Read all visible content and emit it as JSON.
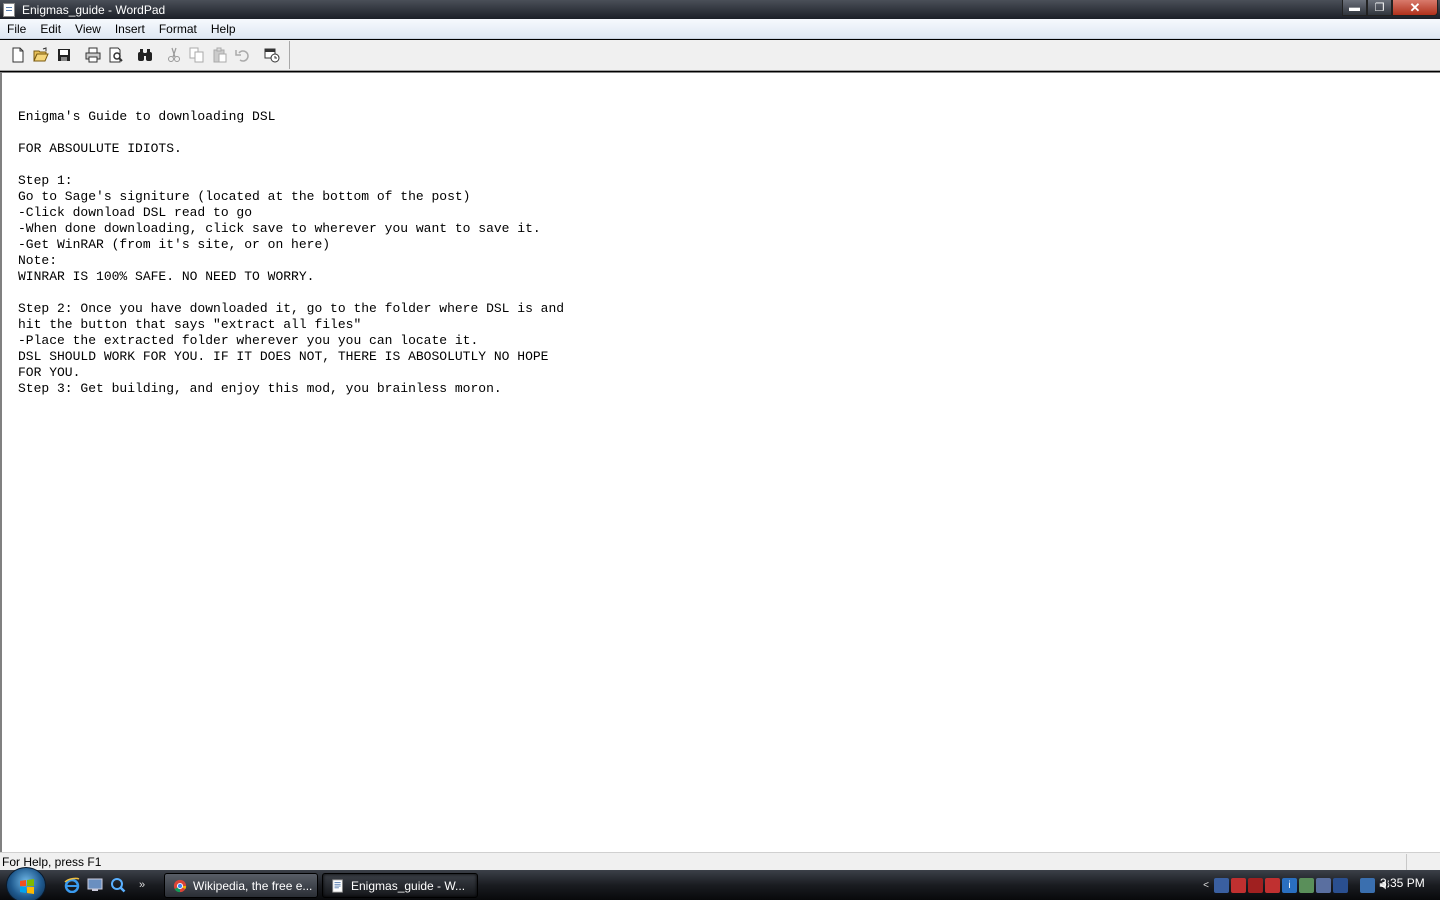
{
  "window": {
    "title": "Enigmas_guide - WordPad",
    "controls": {
      "minimize": "▬",
      "maximize": "❐",
      "close": "✕"
    }
  },
  "menu": [
    "File",
    "Edit",
    "View",
    "Insert",
    "Format",
    "Help"
  ],
  "toolbar": {
    "buttons": [
      "new-icon",
      "open-icon",
      "save-icon",
      "print-icon",
      "print-preview-icon",
      "find-icon",
      "cut-icon",
      "copy-icon",
      "paste-icon",
      "undo-icon",
      "date-time-icon"
    ]
  },
  "document": {
    "lines": [
      "",
      "Enigma's Guide to downloading DSL",
      "",
      "FOR ABSOULUTE IDIOTS.",
      "",
      "Step 1:",
      "Go to Sage's signiture (located at the bottom of the post)",
      "-Click download DSL read to go",
      "-When done downloading, click save to wherever you want to save it.",
      "-Get WinRAR (from it's site, or on here)",
      "Note:",
      "WINRAR IS 100% SAFE. NO NEED TO WORRY.",
      "",
      "Step 2: Once you have downloaded it, go to the folder where DSL is and",
      "hit the button that says \"extract all files\"",
      "-Place the extracted folder wherever you you can locate it.",
      "DSL SHOULD WORK FOR YOU. IF IT DOES NOT, THERE IS ABOSOLUTLY NO HOPE",
      "FOR YOU.",
      "Step 3: Get building, and enjoy this mod, you brainless moron."
    ]
  },
  "status": {
    "text": "For Help, press F1"
  },
  "taskbar": {
    "quick_launch": [
      "internet-explorer-icon",
      "show-desktop-icon",
      "search-icon"
    ],
    "more_label": "»",
    "tasks": [
      {
        "label": "Wikipedia, the free e...",
        "icon": "chrome-icon",
        "active": false
      },
      {
        "label": "Enigmas_guide - W...",
        "icon": "wordpad-icon",
        "active": true
      }
    ],
    "tray_expand": "<",
    "clock": "3:35 PM"
  }
}
